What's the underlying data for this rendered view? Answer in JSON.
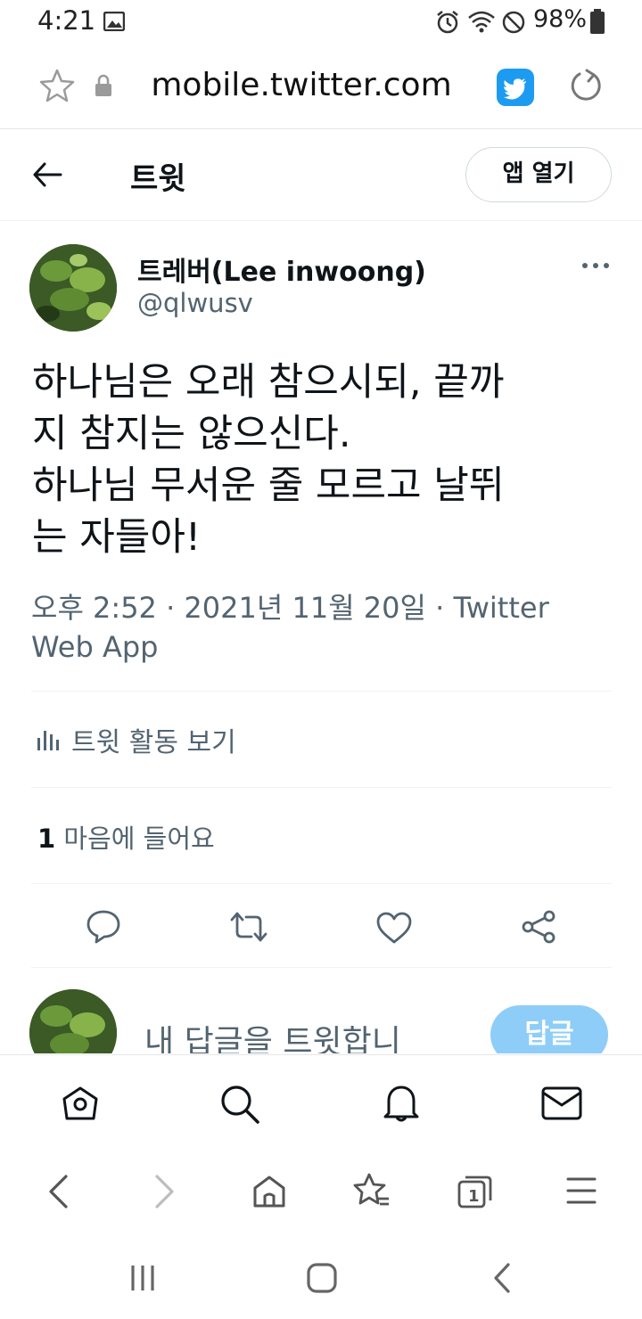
{
  "status_bar": {
    "time": "4:21",
    "battery": "98%"
  },
  "browser": {
    "url": "mobile.twitter.com"
  },
  "header": {
    "title": "트윗",
    "open_app": "앱 열기"
  },
  "tweet": {
    "display_name": "트레버(Lee inwoong)",
    "handle": "@qlwusv",
    "text_lines": [
      "하나님은 오래 참으시되, 끝까",
      "지 참지는 않으신다.",
      "하나님 무서운 줄 모르고 날뛰",
      "는 자들아!"
    ],
    "meta_line1": "오후 2:52 · 2021년 11월 20일 · Twitter",
    "meta_line2": "Web App",
    "activity_label": "트윗 활동 보기",
    "likes_count": "1",
    "likes_label": "마음에 들어요"
  },
  "reply": {
    "placeholder": "내 답글을 트윗합니",
    "button": "답글"
  },
  "icons": {
    "status": [
      "gallery-icon",
      "alarm-icon",
      "wifi-icon",
      "dnd-icon",
      "battery-icon"
    ],
    "actions": [
      "reply-icon",
      "retweet-icon",
      "like-icon",
      "share-icon"
    ],
    "tabs": [
      "home-icon",
      "search-icon",
      "notifications-icon",
      "messages-icon"
    ],
    "browser": [
      "back-icon",
      "forward-icon",
      "home-icon",
      "bookmarks-icon",
      "tabs-icon",
      "menu-icon"
    ]
  },
  "colors": {
    "accent": "#1d9bf0",
    "reply_button": "#8ecdf8",
    "secondary_text": "#536471"
  }
}
